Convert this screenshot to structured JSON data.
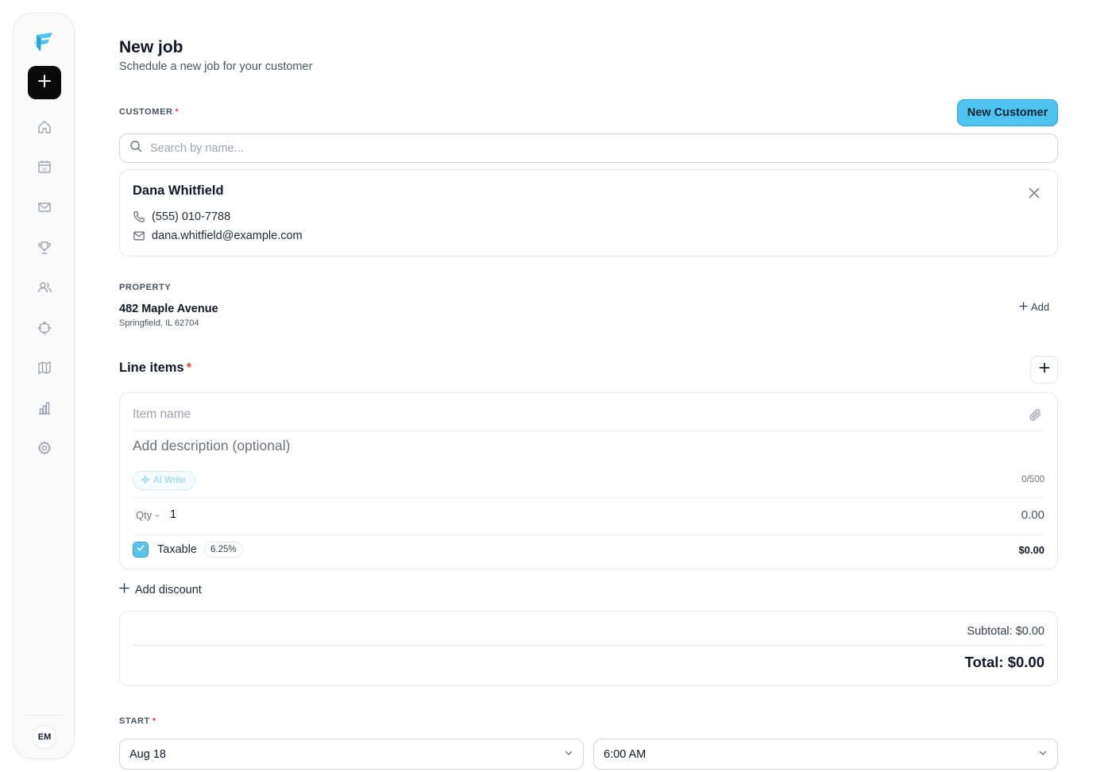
{
  "sidebar": {
    "logo": "brand-logo",
    "new_button_icon": "plus-icon",
    "nav": [
      "home-icon",
      "calendar-icon",
      "mail-icon",
      "trophy-icon",
      "users-icon",
      "crosshair-icon",
      "map-icon",
      "bar-chart-icon",
      "gear-icon"
    ],
    "calendar_day": "31",
    "avatar_initials": "EM"
  },
  "header": {
    "title": "New job",
    "subtitle": "Schedule a new job for your customer"
  },
  "customer": {
    "label": "CUSTOMER",
    "required_mark": "*",
    "new_customer_label": "New Customer",
    "search_placeholder": "Search by name...",
    "search_value": "",
    "selected": {
      "name": "Dana Whitfield",
      "phone": "(555) 010-7788",
      "email": "dana.whitfield@example.com"
    }
  },
  "property": {
    "label": "PROPERTY",
    "street": "482 Maple Avenue",
    "city": "Springfield, IL 62704",
    "add_label": "Add"
  },
  "line_items": {
    "title": "Line items",
    "required_mark": "*",
    "item": {
      "name_placeholder": "Item name",
      "description_placeholder": "Add description (optional)",
      "ai_write_label": "AI Write",
      "char_count": "0/500",
      "qty_label": "Qty",
      "qty_value": "1",
      "price": "0.00",
      "taxable_label": "Taxable",
      "taxable_checked": true,
      "tax_rate": "6.25%",
      "tax_amount": "$0.00"
    },
    "add_discount_label": "Add discount"
  },
  "totals": {
    "subtotal": "Subtotal: $0.00",
    "total": "Total: $0.00"
  },
  "start": {
    "label": "START",
    "required_mark": "*",
    "date": "Aug 18",
    "time": "6:00 AM"
  },
  "colors": {
    "accent": "#4fc3f0",
    "required": "#ef4444",
    "primary_dark": "#0a0a0a"
  }
}
